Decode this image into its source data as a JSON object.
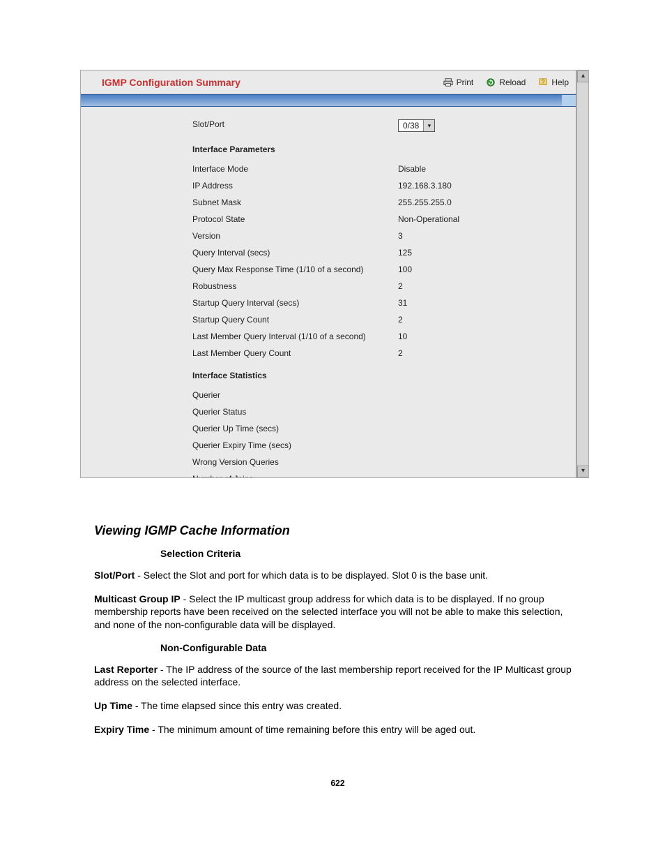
{
  "panel": {
    "title": "IGMP Configuration Summary",
    "toolbar": {
      "print": "Print",
      "reload": "Reload",
      "help": "Help"
    },
    "slotport_label": "Slot/Port",
    "slotport_value": "0/38",
    "section_params": "Interface Parameters",
    "section_stats": "Interface Statistics",
    "params": [
      {
        "label": "Interface Mode",
        "value": "Disable"
      },
      {
        "label": "IP Address",
        "value": "192.168.3.180"
      },
      {
        "label": "Subnet Mask",
        "value": "255.255.255.0"
      },
      {
        "label": "Protocol State",
        "value": "Non-Operational"
      },
      {
        "label": "Version",
        "value": "3"
      },
      {
        "label": "Query Interval (secs)",
        "value": "125"
      },
      {
        "label": "Query Max Response Time (1/10 of a second)",
        "value": "100"
      },
      {
        "label": "Robustness",
        "value": "2"
      },
      {
        "label": "Startup Query Interval (secs)",
        "value": "31"
      },
      {
        "label": "Startup Query Count",
        "value": "2"
      },
      {
        "label": "Last Member Query Interval (1/10 of a second)",
        "value": "10"
      },
      {
        "label": "Last Member Query Count",
        "value": "2"
      }
    ],
    "stats": [
      {
        "label": "Querier",
        "value": ""
      },
      {
        "label": "Querier Status",
        "value": ""
      },
      {
        "label": "Querier Up Time (secs)",
        "value": ""
      },
      {
        "label": "Querier Expiry Time (secs)",
        "value": ""
      },
      {
        "label": "Wrong Version Queries",
        "value": ""
      },
      {
        "label": "Number of Joins",
        "value": ""
      }
    ]
  },
  "doc": {
    "heading": "Viewing IGMP Cache Information",
    "sub1": "Selection Criteria",
    "slotport_term": "Slot/Port",
    "slotport_text": " - Select the Slot and port for which data is to be displayed. Slot 0 is the base unit.",
    "mgroup_term": "Multicast Group IP",
    "mgroup_text": " - Select the IP multicast group address for which data is to be displayed. If no group membership reports have been received on the selected interface you will not be able to make this selection, and none of the non-configurable data will be displayed.",
    "sub2": "Non-Configurable Data",
    "lastrep_term": "Last Reporter",
    "lastrep_text": " - The IP address of the source of the last membership report received for the IP Multicast group address on the selected interface.",
    "uptime_term": "Up Time",
    "uptime_text": " - The time elapsed since this entry was created.",
    "expiry_term": "Expiry Time",
    "expiry_text": " - The minimum amount of time remaining before this entry will be aged out.",
    "pagenum": "622"
  }
}
